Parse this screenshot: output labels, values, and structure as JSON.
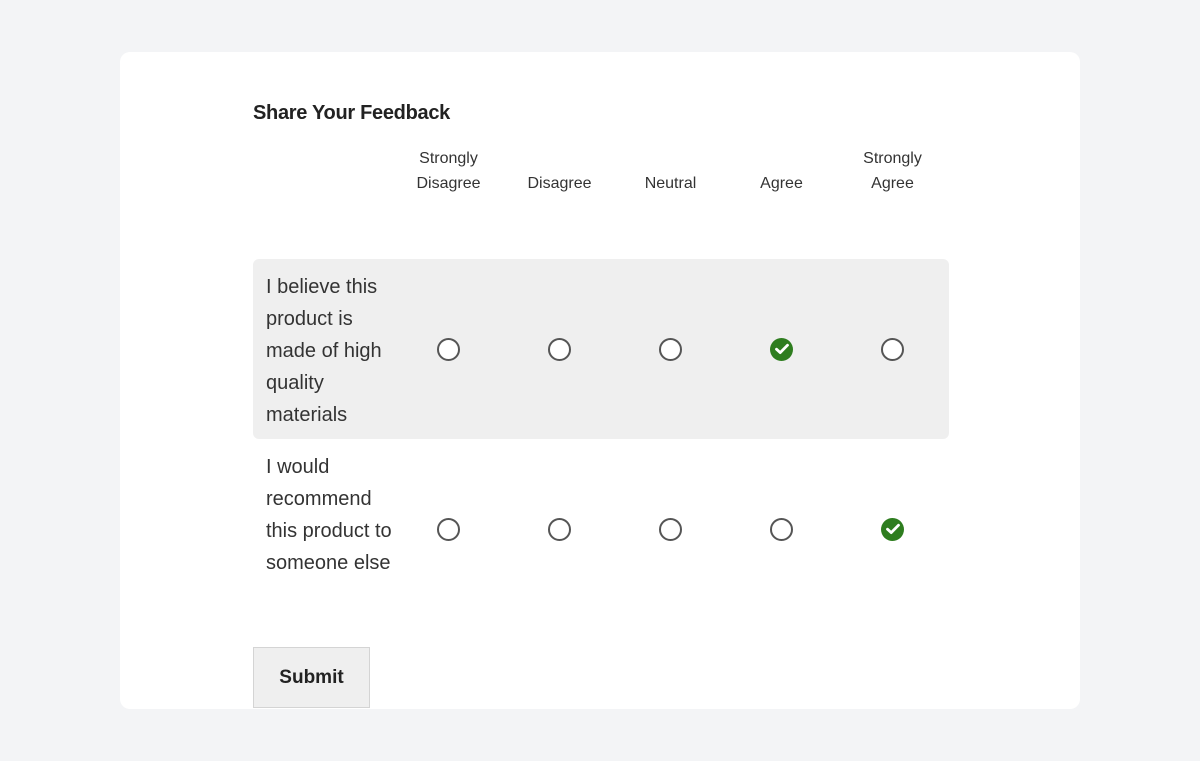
{
  "form": {
    "title": "Share Your Feedback",
    "columns": [
      "Strongly Disagree",
      "Disagree",
      "Neutral",
      "Agree",
      "Strongly Agree"
    ],
    "column_lines": [
      [
        "Strongly",
        "Disagree"
      ],
      [
        "Disagree"
      ],
      [
        "Neutral"
      ],
      [
        "Agree"
      ],
      [
        "Strongly",
        "Agree"
      ]
    ],
    "rows": [
      {
        "statement": "I believe this product is made of high quality materials",
        "selected": "Agree",
        "selected_index": 3
      },
      {
        "statement": "I would recommend this product to someone else",
        "selected": "Strongly Agree",
        "selected_index": 4
      }
    ],
    "submit_label": "Submit"
  },
  "colors": {
    "checked": "#2e7d1f",
    "row_shade": "#efefef",
    "page_bg": "#f3f4f6"
  }
}
